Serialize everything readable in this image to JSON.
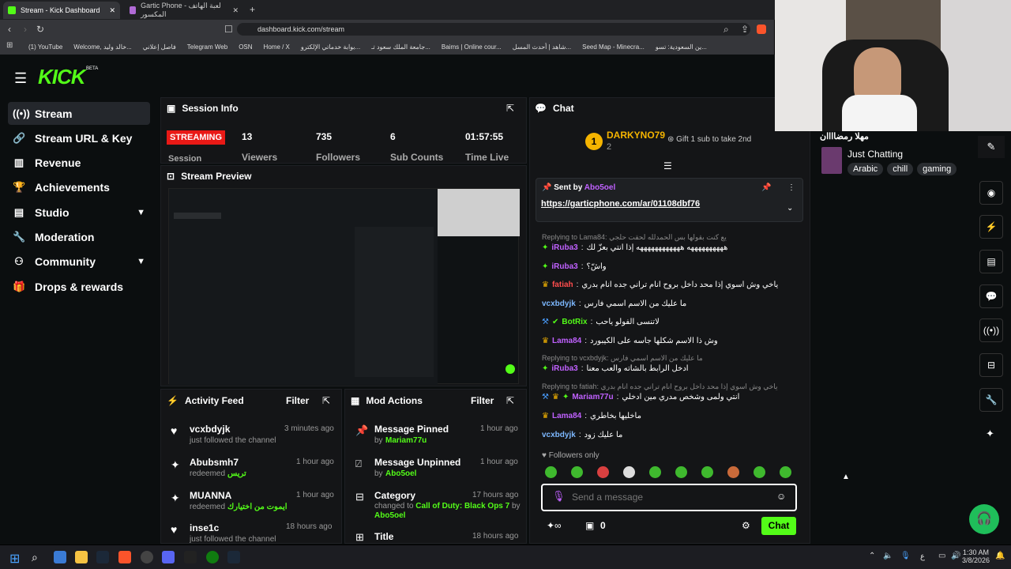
{
  "browser": {
    "tabs": [
      {
        "title": "Stream - Kick Dashboard"
      },
      {
        "title": "Gartic Phone - لعبة الهاتف المكسور"
      }
    ],
    "url": "dashboard.kick.com/stream",
    "bookmarks": [
      "(1) YouTube",
      "Welcome, خالد وليد...",
      "فاصل إعلاني",
      "Telegram Web",
      "OSN",
      "Home / X",
      "بوابة خدماتي الإلكترو...",
      "جامعة الملك سعود تـ...",
      "Baims | Online cour...",
      "شاهد | أحدث المسل...",
      "Seed Map - Minecra...",
      "ين السعودية: تسو..."
    ]
  },
  "brand": {
    "logo": "KICK",
    "badge": "BETA",
    "accent": "#53fc18"
  },
  "sidebar": {
    "items": [
      {
        "label": "Stream",
        "icon": "broadcast-icon"
      },
      {
        "label": "Stream URL & Key",
        "icon": "link-icon"
      },
      {
        "label": "Revenue",
        "icon": "chart-icon"
      },
      {
        "label": "Achievements",
        "icon": "trophy-icon"
      },
      {
        "label": "Studio",
        "icon": "studio-icon"
      },
      {
        "label": "Moderation",
        "icon": "wrench-icon"
      },
      {
        "label": "Community",
        "icon": "community-icon"
      },
      {
        "label": "Drops & rewards",
        "icon": "gift-icon"
      }
    ]
  },
  "session": {
    "title": "Session Info",
    "status": "STREAMING",
    "status_label": "Session",
    "viewers": "13",
    "viewers_label": "Viewers",
    "followers": "735",
    "followers_label": "Followers",
    "subs": "6",
    "subs_label": "Sub Counts",
    "time": "01:57:55",
    "time_label": "Time Live"
  },
  "preview": {
    "title": "Stream Preview"
  },
  "activity": {
    "title": "Activity Feed",
    "filter": "Filter",
    "items": [
      {
        "user": "vcxbdyjk",
        "text": "just followed the channel",
        "extra": "",
        "time": "3 minutes ago"
      },
      {
        "user": "Abubsmh7",
        "text": "redeemed",
        "extra": "تريس",
        "time": "1 hour ago"
      },
      {
        "user": "MUANNA",
        "text": "redeemed",
        "extra": "ايموت من اختيارك",
        "time": "1 hour ago"
      },
      {
        "user": "inse1c",
        "text": "just followed the channel",
        "extra": "",
        "time": "18 hours ago"
      }
    ]
  },
  "mod": {
    "title": "Mod Actions",
    "filter": "Filter",
    "items": [
      {
        "action": "Message Pinned",
        "by": "by",
        "user": "Mariam77u",
        "time": "1 hour ago"
      },
      {
        "action": "Message Unpinned",
        "by": "by",
        "user": "Abo5oel",
        "time": "1 hour ago"
      },
      {
        "action": "Category",
        "by": "changed to",
        "user": "Call of Duty: Black Ops 7",
        "by2": "by",
        "user2": "Abo5oel",
        "time": "17 hours ago"
      },
      {
        "action": "Title",
        "by": "",
        "user": "",
        "time": "18 hours ago"
      }
    ]
  },
  "chat": {
    "title": "Chat",
    "top_gifter": "DARKYNO79",
    "top_rank": "1",
    "top_count": "2",
    "gift_text": "Gift 1 sub to take 2nd",
    "pinned_label": "Sent by",
    "pinned_user": "Abo5oel",
    "pinned_link": "https://garticphone.com/ar/01108dbf76",
    "reply1": "Replying to Lama84: يع كنت بقولها بس الحمدلله لحقت حلجي",
    "m1_user": "iRuba3",
    "m1_text": "ههههههههههه ههههههههههههه إذا انتي بعزّ لك",
    "m2_user": "iRuba3",
    "m2_text": "واشّ؟",
    "m3_user": "fatiah",
    "m3_text": "ياخي وش اسوي إذا محد داخل بروح انام تراني جده انام بدري",
    "m4_user": "vcxbdyjk",
    "m4_text": "ما عليك من الاسم اسمي فارس",
    "m5_user": "BotRix",
    "m5_text": "لاتنسى الفولو ياحب",
    "m6_user": "Lama84",
    "m6_text": "وش ذا الاسم شكلها جاسه على الكيبورد",
    "reply2": "Replying to vcxbdyjk: ما عليك من الاسم اسمي فارس",
    "m7_user": "iRuba3",
    "m7_text": "ادخل الرابط بالشاته والعب معنا",
    "reply3": "Replying to fatiah: ياخي وش اسوي إذا محد داخل بروح انام تراني جده انام بدري",
    "m8_user": "Mariam77u",
    "m8_text": "انتي ولمى وشخص مدري مين ادخلي",
    "m9_user": "Lama84",
    "m9_text": "ماخليها بخاطري",
    "m10_user": "vcxbdyjk",
    "m10_text": "ما عليك زود",
    "followers_only": "Followers only",
    "placeholder": "Send a message",
    "points": "0",
    "send": "Chat"
  },
  "channel": {
    "name": "مهلا رمضاااان",
    "category": "Just Chatting",
    "tags": [
      "Arabic",
      "chill",
      "gaming"
    ]
  },
  "taskbar": {
    "time": "1:30 AM",
    "date": "3/8/2026",
    "lang": "ع"
  }
}
